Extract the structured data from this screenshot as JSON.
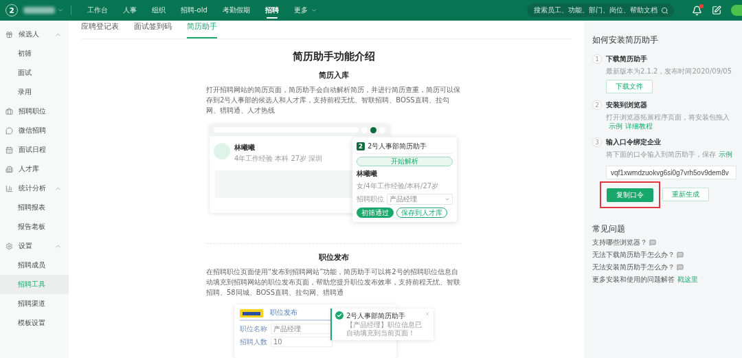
{
  "topbar": {
    "logo_text": "2",
    "nav": [
      {
        "label": "工作台",
        "selected": false,
        "caret": false
      },
      {
        "label": "人事",
        "selected": false,
        "caret": false
      },
      {
        "label": "组织",
        "selected": false,
        "caret": false
      },
      {
        "label": "招聘-old",
        "selected": false,
        "caret": false
      },
      {
        "label": "考勤假期",
        "selected": false,
        "caret": false
      },
      {
        "label": "招聘",
        "selected": true,
        "caret": false
      },
      {
        "label": "更多",
        "selected": false,
        "caret": true
      }
    ],
    "search": {
      "placeholder": "搜索员工、功能、部门、岗位、帮助文档"
    },
    "has_notification": true
  },
  "sidebar": {
    "items": [
      {
        "label": "候选人",
        "selected": false,
        "expanded": true,
        "children": [
          {
            "label": "初筛",
            "selected": false
          },
          {
            "label": "面试",
            "selected": false
          },
          {
            "label": "录用",
            "selected": false
          }
        ]
      },
      {
        "label": "招聘职位",
        "selected": false
      },
      {
        "label": "微信招聘",
        "selected": false
      },
      {
        "label": "面试日程",
        "selected": false
      },
      {
        "label": "人才库",
        "selected": false
      },
      {
        "label": "统计分析",
        "selected": false,
        "expanded": true,
        "children": [
          {
            "label": "招聘报表",
            "selected": false
          },
          {
            "label": "报告老板",
            "selected": false
          }
        ]
      },
      {
        "label": "设置",
        "selected": false,
        "expanded": true,
        "children": [
          {
            "label": "招聘成员",
            "selected": false
          },
          {
            "label": "招聘工具",
            "selected": true
          },
          {
            "label": "招聘渠道",
            "selected": false
          },
          {
            "label": "模板设置",
            "selected": false
          }
        ]
      }
    ]
  },
  "tabs": [
    {
      "label": "应聘登记表",
      "selected": false
    },
    {
      "label": "面试签到码",
      "selected": false
    },
    {
      "label": "简历助手",
      "selected": true
    }
  ],
  "intro": {
    "title": "简历助手功能介绍",
    "sections": [
      {
        "heading": "简历入库",
        "body": "打开招聘网站的简历页面，简历助手会自动解析简历，并进行简历查重，简历可以保存到2号人事部的候选人和人才库，支持前程无忧、智联招聘、BOSS直聘、拉勾网、猎聘通、人才热线",
        "illustration": {
          "kind": "resume",
          "name": "林曦曦",
          "meta": [
            "4年工作经验",
            "本科",
            "27岁",
            "深圳"
          ],
          "popup": {
            "logo": "2",
            "title": "2号人事部简历助手",
            "parse_button": "开始解析",
            "name": "林曦曦",
            "meta": "女/4年工作经验/本科/27岁",
            "field_label": "招聘职位",
            "field_value": "产品经理",
            "buttons": [
              "初筛通过",
              "保存到人才库"
            ]
          }
        }
      },
      {
        "heading": "职位发布",
        "body": "在招聘职位页面使用“发布到招聘网站”功能，简历助手可以将2号的招聘职位信息自动填充到招聘网站的职位发布页面，帮助您提升职位发布效率，支持前程无忧、智联招聘、58同城、BOSS直聘、拉勾网、猎聘通",
        "illustration": {
          "kind": "job",
          "site_tab": "职位发布",
          "fields": [
            {
              "label": "职位名称",
              "value": "产品经理"
            },
            {
              "label": "招聘人数",
              "value": "10"
            }
          ],
          "toast": {
            "title": "2号人事部简历助手",
            "message": "【产品经理】职位信息已自动填充到当前页面！"
          }
        }
      }
    ]
  },
  "install": {
    "title": "如何安装简历助手",
    "steps": [
      {
        "number": "1",
        "title": "下载简历助手",
        "desc": "最新版本为2.1.2，发布时间2020/09/05",
        "button": "下载文件"
      },
      {
        "number": "2",
        "title": "安装到浏览器",
        "desc": "打开浏览器拓展程序页面，将安装包拖入",
        "links": [
          "示例",
          "详细教程"
        ]
      },
      {
        "number": "3",
        "title": "输入口令绑定企业",
        "desc": "将下面的口令输入到简历助手，保存",
        "links": [
          "示例"
        ],
        "token": "vqf1xwmdzuokvg6si0g7vrh5ov9dem8v",
        "buttons": [
          {
            "label": "复制口令",
            "kind": "primary",
            "highlighted": true
          },
          {
            "label": "重新生成",
            "kind": "secondary",
            "highlighted": false
          }
        ]
      }
    ]
  },
  "faq": {
    "title": "常见问题",
    "items": [
      {
        "kind": "question",
        "text": "支持哪些浏览器？"
      },
      {
        "kind": "question",
        "text": "无法下载简历助手怎么办？"
      },
      {
        "kind": "question",
        "text": "无法安装简历助手怎么办？"
      },
      {
        "kind": "more",
        "text": "更多安装和使用的问题解答",
        "link": "戳这里"
      }
    ]
  }
}
